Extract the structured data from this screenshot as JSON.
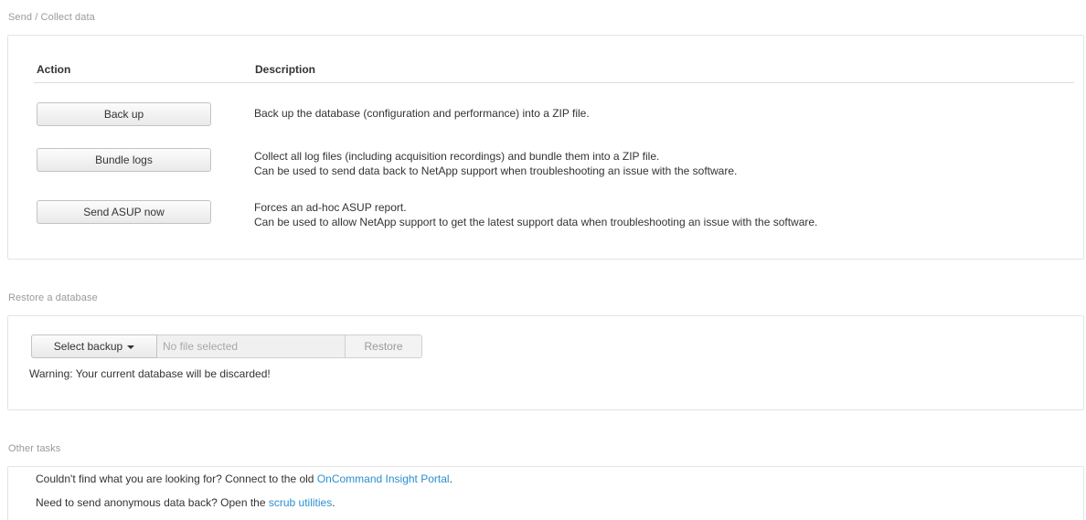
{
  "send_collect": {
    "section_title": "Send / Collect data",
    "col_action": "Action",
    "col_description": "Description",
    "rows": [
      {
        "button": "Back up",
        "desc1": "Back up the database (configuration and performance) into a ZIP file.",
        "desc2": ""
      },
      {
        "button": "Bundle logs",
        "desc1": "Collect all log files (including acquisition recordings) and bundle them into a ZIP file.",
        "desc2": "Can be used to send data back to NetApp support when troubleshooting an issue with the software."
      },
      {
        "button": "Send ASUP now",
        "desc1": "Forces an ad-hoc ASUP report.",
        "desc2": "Can be used to allow NetApp support to get the latest support data when troubleshooting an issue with the software."
      }
    ]
  },
  "restore": {
    "section_title": "Restore a database",
    "select_label": "Select backup",
    "file_placeholder": "No file selected",
    "restore_label": "Restore",
    "warning": "Warning: Your current database will be discarded!"
  },
  "other": {
    "section_title": "Other tasks",
    "line1_prefix": "Couldn't find what you are looking for? Connect to the old ",
    "line1_link": "OnCommand Insight Portal",
    "line1_suffix": ".",
    "line2_prefix": "Need to send anonymous data back? Open the ",
    "line2_link": "scrub utilities",
    "line2_suffix": "."
  },
  "colors": {
    "link": "#2b8fd1",
    "section_title": "#9a9a9a",
    "panel_border": "#e4e4e4"
  }
}
